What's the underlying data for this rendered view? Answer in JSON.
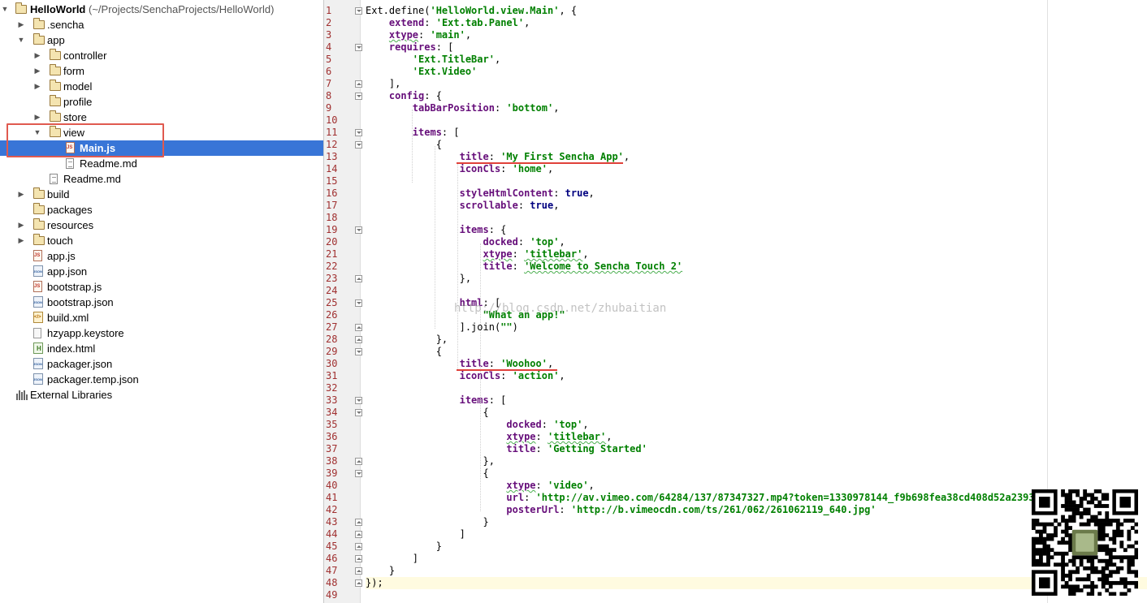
{
  "tree": {
    "root": {
      "name": "HelloWorld",
      "path": "(~/Projects/SenchaProjects/HelloWorld)"
    },
    "items": [
      {
        "label": ".sencha",
        "kind": "folder",
        "depth": 1,
        "expander": "collapsed"
      },
      {
        "label": "app",
        "kind": "folder",
        "depth": 1,
        "expander": "expanded"
      },
      {
        "label": "controller",
        "kind": "folder",
        "depth": 2,
        "expander": "collapsed"
      },
      {
        "label": "form",
        "kind": "folder",
        "depth": 2,
        "expander": "collapsed"
      },
      {
        "label": "model",
        "kind": "folder",
        "depth": 2,
        "expander": "collapsed"
      },
      {
        "label": "profile",
        "kind": "folder",
        "depth": 2,
        "expander": "none"
      },
      {
        "label": "store",
        "kind": "folder",
        "depth": 2,
        "expander": "collapsed"
      },
      {
        "label": "view",
        "kind": "folder",
        "depth": 2,
        "expander": "expanded"
      },
      {
        "label": "Main.js",
        "kind": "js",
        "depth": 3,
        "expander": "none",
        "selected": true
      },
      {
        "label": "Readme.md",
        "kind": "md",
        "depth": 3,
        "expander": "none"
      },
      {
        "label": "Readme.md",
        "kind": "md",
        "depth": 2,
        "expander": "none"
      },
      {
        "label": "build",
        "kind": "folder",
        "depth": 1,
        "expander": "collapsed"
      },
      {
        "label": "packages",
        "kind": "folder",
        "depth": 1,
        "expander": "none"
      },
      {
        "label": "resources",
        "kind": "folder",
        "depth": 1,
        "expander": "collapsed"
      },
      {
        "label": "touch",
        "kind": "folder",
        "depth": 1,
        "expander": "collapsed"
      },
      {
        "label": "app.js",
        "kind": "js",
        "depth": 1,
        "expander": "none"
      },
      {
        "label": "app.json",
        "kind": "json",
        "depth": 1,
        "expander": "none"
      },
      {
        "label": "bootstrap.js",
        "kind": "js",
        "depth": 1,
        "expander": "none"
      },
      {
        "label": "bootstrap.json",
        "kind": "json",
        "depth": 1,
        "expander": "none"
      },
      {
        "label": "build.xml",
        "kind": "xml",
        "depth": 1,
        "expander": "none"
      },
      {
        "label": "hzyapp.keystore",
        "kind": "key",
        "depth": 1,
        "expander": "none"
      },
      {
        "label": "index.html",
        "kind": "html",
        "depth": 1,
        "expander": "none"
      },
      {
        "label": "packager.json",
        "kind": "json",
        "depth": 1,
        "expander": "none"
      },
      {
        "label": "packager.temp.json",
        "kind": "json",
        "depth": 1,
        "expander": "none"
      },
      {
        "label": "External Libraries",
        "kind": "lib",
        "depth": 0,
        "expander": "none"
      }
    ]
  },
  "editor": {
    "current_line": 48,
    "lines": [
      {
        "n": "1",
        "fold": "open",
        "tokens": [
          [
            "fn",
            "Ext.define("
          ],
          [
            "s",
            "'HelloWorld.view.Main'"
          ],
          [
            "p",
            ", {"
          ]
        ]
      },
      {
        "n": "2",
        "tokens": [
          [
            "p",
            "    "
          ],
          [
            "k",
            "extend"
          ],
          [
            "p",
            ": "
          ],
          [
            "s",
            "'Ext.tab.Panel'"
          ],
          [
            "p",
            ","
          ]
        ]
      },
      {
        "n": "3",
        "tokens": [
          [
            "p",
            "    "
          ],
          [
            "k",
            "xtype"
          ],
          [
            "p",
            ": "
          ],
          [
            "s",
            "'main'"
          ],
          [
            "p",
            ","
          ]
        ]
      },
      {
        "n": "4",
        "fold": "open",
        "tokens": [
          [
            "p",
            "    "
          ],
          [
            "k",
            "requires"
          ],
          [
            "p",
            ": ["
          ]
        ]
      },
      {
        "n": "5",
        "tokens": [
          [
            "p",
            "        "
          ],
          [
            "s",
            "'Ext.TitleBar'"
          ],
          [
            "p",
            ","
          ]
        ]
      },
      {
        "n": "6",
        "tokens": [
          [
            "p",
            "        "
          ],
          [
            "s",
            "'Ext.Video'"
          ]
        ]
      },
      {
        "n": "7",
        "fold": "close",
        "tokens": [
          [
            "p",
            "    ],"
          ]
        ]
      },
      {
        "n": "8",
        "fold": "open",
        "tokens": [
          [
            "p",
            "    "
          ],
          [
            "k",
            "config"
          ],
          [
            "p",
            ": {"
          ]
        ]
      },
      {
        "n": "9",
        "tokens": [
          [
            "p",
            "        "
          ],
          [
            "k",
            "tabBarPosition"
          ],
          [
            "p",
            ": "
          ],
          [
            "s",
            "'bottom'"
          ],
          [
            "p",
            ","
          ]
        ]
      },
      {
        "n": "10",
        "tokens": []
      },
      {
        "n": "11",
        "fold": "open",
        "tokens": [
          [
            "p",
            "        "
          ],
          [
            "k",
            "items"
          ],
          [
            "p",
            ": ["
          ]
        ]
      },
      {
        "n": "12",
        "fold": "open",
        "tokens": [
          [
            "p",
            "            {"
          ]
        ]
      },
      {
        "n": "13",
        "tokens": [
          [
            "p",
            "                "
          ],
          [
            "k",
            "title"
          ],
          [
            "p",
            ": "
          ],
          [
            "s",
            "'My First Sencha App'"
          ],
          [
            "p",
            ","
          ]
        ]
      },
      {
        "n": "14",
        "tokens": [
          [
            "p",
            "                "
          ],
          [
            "k",
            "iconCls"
          ],
          [
            "p",
            ": "
          ],
          [
            "s",
            "'home'"
          ],
          [
            "p",
            ","
          ]
        ]
      },
      {
        "n": "15",
        "tokens": []
      },
      {
        "n": "16",
        "tokens": [
          [
            "p",
            "                "
          ],
          [
            "k",
            "styleHtmlContent"
          ],
          [
            "p",
            ": "
          ],
          [
            "kw",
            "true"
          ],
          [
            "p",
            ","
          ]
        ]
      },
      {
        "n": "17",
        "tokens": [
          [
            "p",
            "                "
          ],
          [
            "k",
            "scrollable"
          ],
          [
            "p",
            ": "
          ],
          [
            "kw",
            "true"
          ],
          [
            "p",
            ","
          ]
        ]
      },
      {
        "n": "18",
        "tokens": []
      },
      {
        "n": "19",
        "fold": "open",
        "tokens": [
          [
            "p",
            "                "
          ],
          [
            "k",
            "items"
          ],
          [
            "p",
            ": {"
          ]
        ]
      },
      {
        "n": "20",
        "tokens": [
          [
            "p",
            "                    "
          ],
          [
            "k",
            "docked"
          ],
          [
            "p",
            ": "
          ],
          [
            "s",
            "'top'"
          ],
          [
            "p",
            ","
          ]
        ]
      },
      {
        "n": "21",
        "tokens": [
          [
            "p",
            "                    "
          ],
          [
            "k",
            "xtype"
          ],
          [
            "p",
            ": "
          ],
          [
            "s",
            "'titlebar'"
          ],
          [
            "p",
            ","
          ]
        ]
      },
      {
        "n": "22",
        "tokens": [
          [
            "p",
            "                    "
          ],
          [
            "k",
            "title"
          ],
          [
            "p",
            ": "
          ],
          [
            "s",
            "'Welcome to Sencha Touch 2'"
          ]
        ]
      },
      {
        "n": "23",
        "fold": "close",
        "tokens": [
          [
            "p",
            "                },"
          ]
        ]
      },
      {
        "n": "24",
        "tokens": []
      },
      {
        "n": "25",
        "fold": "open",
        "tokens": [
          [
            "p",
            "                "
          ],
          [
            "k",
            "html"
          ],
          [
            "p",
            ": ["
          ]
        ]
      },
      {
        "n": "26",
        "tokens": [
          [
            "p",
            "                    "
          ],
          [
            "s",
            "\"What an app!\""
          ]
        ]
      },
      {
        "n": "27",
        "fold": "close",
        "tokens": [
          [
            "p",
            "                ]."
          ],
          [
            "fn",
            "join"
          ],
          [
            "p",
            "("
          ],
          [
            "s",
            "\"\""
          ],
          [
            "p",
            ")"
          ]
        ]
      },
      {
        "n": "28",
        "fold": "close",
        "tokens": [
          [
            "p",
            "            },"
          ]
        ]
      },
      {
        "n": "29",
        "fold": "open",
        "tokens": [
          [
            "p",
            "            {"
          ]
        ]
      },
      {
        "n": "30",
        "tokens": [
          [
            "p",
            "                "
          ],
          [
            "k",
            "title"
          ],
          [
            "p",
            ": "
          ],
          [
            "s",
            "'Woohoo'"
          ],
          [
            "p",
            ","
          ]
        ]
      },
      {
        "n": "31",
        "tokens": [
          [
            "p",
            "                "
          ],
          [
            "k",
            "iconCls"
          ],
          [
            "p",
            ": "
          ],
          [
            "s",
            "'action'"
          ],
          [
            "p",
            ","
          ]
        ]
      },
      {
        "n": "32",
        "tokens": []
      },
      {
        "n": "33",
        "fold": "open",
        "tokens": [
          [
            "p",
            "                "
          ],
          [
            "k",
            "items"
          ],
          [
            "p",
            ": ["
          ]
        ]
      },
      {
        "n": "34",
        "fold": "open",
        "tokens": [
          [
            "p",
            "                    {"
          ]
        ]
      },
      {
        "n": "35",
        "tokens": [
          [
            "p",
            "                        "
          ],
          [
            "k",
            "docked"
          ],
          [
            "p",
            ": "
          ],
          [
            "s",
            "'top'"
          ],
          [
            "p",
            ","
          ]
        ]
      },
      {
        "n": "36",
        "tokens": [
          [
            "p",
            "                        "
          ],
          [
            "k",
            "xtype"
          ],
          [
            "p",
            ": "
          ],
          [
            "s",
            "'titlebar'"
          ],
          [
            "p",
            ","
          ]
        ]
      },
      {
        "n": "37",
        "tokens": [
          [
            "p",
            "                        "
          ],
          [
            "k",
            "title"
          ],
          [
            "p",
            ": "
          ],
          [
            "s",
            "'Getting Started'"
          ]
        ]
      },
      {
        "n": "38",
        "fold": "close",
        "tokens": [
          [
            "p",
            "                    },"
          ]
        ]
      },
      {
        "n": "39",
        "fold": "open",
        "tokens": [
          [
            "p",
            "                    {"
          ]
        ]
      },
      {
        "n": "40",
        "tokens": [
          [
            "p",
            "                        "
          ],
          [
            "k",
            "xtype"
          ],
          [
            "p",
            ": "
          ],
          [
            "s",
            "'video'"
          ],
          [
            "p",
            ","
          ]
        ]
      },
      {
        "n": "41",
        "tokens": [
          [
            "p",
            "                        "
          ],
          [
            "k",
            "url"
          ],
          [
            "p",
            ": "
          ],
          [
            "s",
            "'http://av.vimeo.com/64284/137/87347327.mp4?token=1330978144_f9b698fea38cd408d52a239324"
          ]
        ]
      },
      {
        "n": "42",
        "tokens": [
          [
            "p",
            "                        "
          ],
          [
            "k",
            "posterUrl"
          ],
          [
            "p",
            ": "
          ],
          [
            "s",
            "'http://b.vimeocdn.com/ts/261/062/261062119_640.jpg'"
          ]
        ]
      },
      {
        "n": "43",
        "fold": "close",
        "tokens": [
          [
            "p",
            "                    }"
          ]
        ]
      },
      {
        "n": "44",
        "fold": "close",
        "tokens": [
          [
            "p",
            "                ]"
          ]
        ]
      },
      {
        "n": "45",
        "fold": "close",
        "tokens": [
          [
            "p",
            "            }"
          ]
        ]
      },
      {
        "n": "46",
        "fold": "close",
        "tokens": [
          [
            "p",
            "        ]"
          ]
        ]
      },
      {
        "n": "47",
        "fold": "close",
        "tokens": [
          [
            "p",
            "    }"
          ]
        ]
      },
      {
        "n": "48",
        "fold": "close",
        "tokens": [
          [
            "p",
            "});"
          ]
        ]
      },
      {
        "n": "49",
        "tokens": []
      }
    ]
  },
  "watermark": "http://blog.csdn.net/zhubaitian",
  "colors": {
    "selection": "#3875d7",
    "annotation": "#e0413a",
    "keyword": "#660e7a",
    "string": "#008000",
    "line_number": "#a03030"
  }
}
